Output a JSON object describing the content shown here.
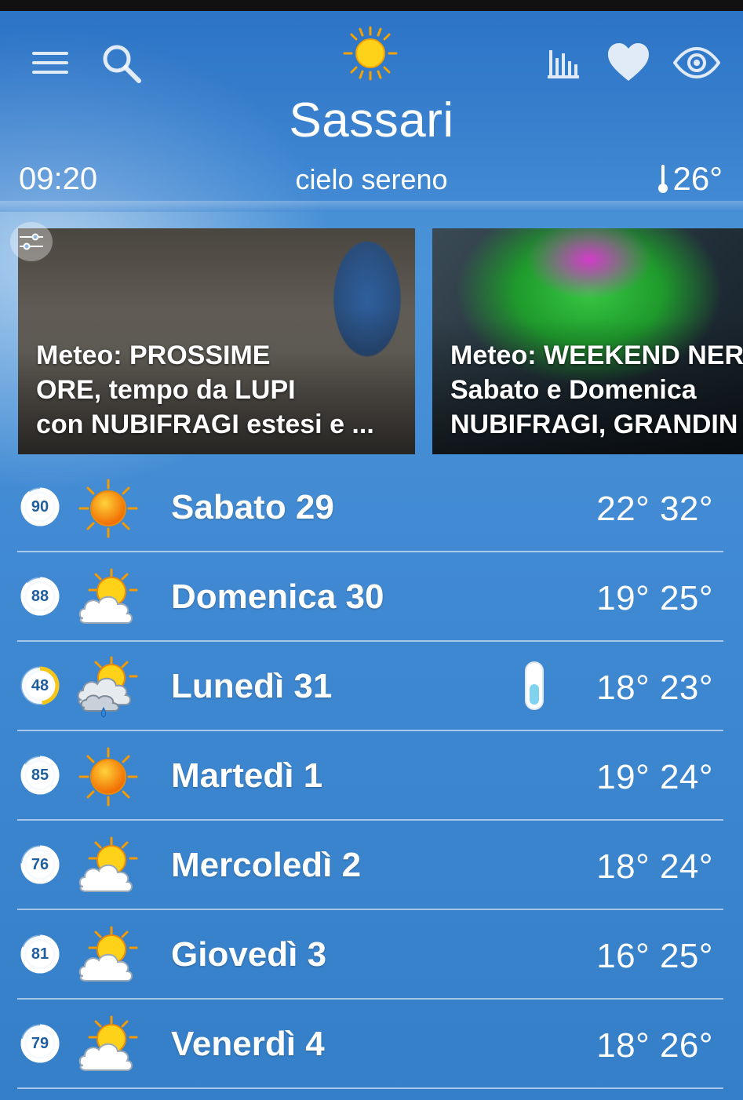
{
  "header": {
    "city": "Sassari",
    "time": "09:20",
    "condition": "cielo sereno",
    "current_temp": "26°",
    "icons": [
      "menu-icon",
      "search-icon",
      "sun-icon",
      "stats-chart-icon",
      "heart-icon",
      "eye-icon",
      "thermometer-icon"
    ]
  },
  "news": [
    {
      "title": "Meteo: PROSSIME\nORE, tempo da LUPI\ncon NUBIFRAGI estesi e ..."
    },
    {
      "title": "Meteo: WEEKEND NER\nSabato e Domenica\nNUBIFRAGI, GRANDIN"
    }
  ],
  "forecast": [
    {
      "day": "Sabato 29",
      "temps": "22° 32°",
      "prob": "90",
      "prob_fraction": 0.9,
      "icon": "sun-icon"
    },
    {
      "day": "Domenica 30",
      "temps": "19° 25°",
      "prob": "88",
      "prob_fraction": 0.88,
      "icon": "sun-cloud-icon"
    },
    {
      "day": "Lunedì 31",
      "temps": "18° 23°",
      "prob": "48",
      "prob_fraction": 0.48,
      "icon": "sun-cloud-rain-icon",
      "badge": "thermometer-icon"
    },
    {
      "day": "Martedì 1",
      "temps": "19° 24°",
      "prob": "85",
      "prob_fraction": 0.85,
      "icon": "sun-icon"
    },
    {
      "day": "Mercoledì 2",
      "temps": "18° 24°",
      "prob": "76",
      "prob_fraction": 0.76,
      "icon": "sun-cloud-icon"
    },
    {
      "day": "Giovedì 3",
      "temps": "16° 25°",
      "prob": "81",
      "prob_fraction": 0.81,
      "icon": "sun-cloud-icon"
    },
    {
      "day": "Venerdì 4",
      "temps": "18° 26°",
      "prob": "79",
      "prob_fraction": 0.79,
      "icon": "sun-cloud-icon"
    }
  ],
  "colors": {
    "accent_ring": "#ffffff",
    "low_prob_ring": "#f5c518",
    "sky_blue": "#3f88d2"
  }
}
